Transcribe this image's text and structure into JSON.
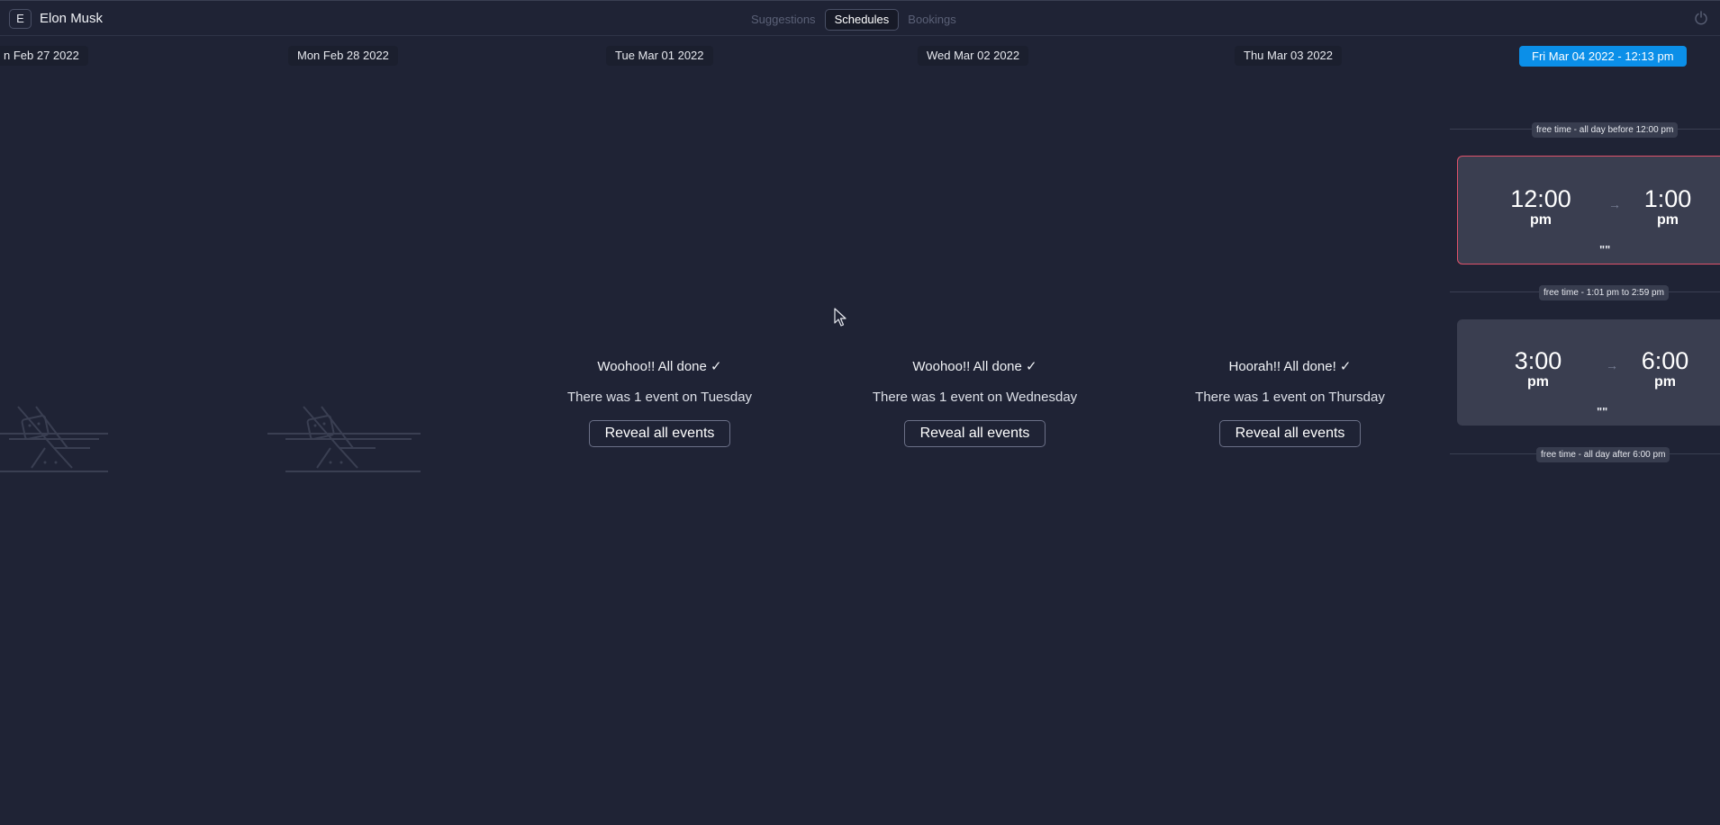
{
  "header": {
    "avatar_letter": "E",
    "username": "Elon Musk",
    "tabs": [
      "Suggestions",
      "Schedules",
      "Bookings"
    ],
    "active_tab": "Schedules"
  },
  "days": [
    {
      "date": "n Feb 27 2022"
    },
    {
      "date": "Mon Feb 28 2022"
    },
    {
      "date": "Tue Mar 01 2022",
      "title": "Woohoo!! All done ✓",
      "subtitle": "There was 1 event on Tuesday",
      "button": "Reveal all events"
    },
    {
      "date": "Wed Mar 02 2022",
      "title": "Woohoo!! All done ✓",
      "subtitle": "There was 1 event on Wednesday",
      "button": "Reveal all events"
    },
    {
      "date": "Thu Mar 03 2022",
      "title": "Hoorah!! All done! ✓",
      "subtitle": "There was 1 event on Thursday",
      "button": "Reveal all events"
    }
  ],
  "today": {
    "date": "Fri Mar 04 2022  - 12:13 pm",
    "free_before": "free time - all day before 12:00 pm",
    "event1": {
      "start": "12:00",
      "start_ampm": "pm",
      "end": "1:00",
      "end_ampm": "pm",
      "note": "\"\""
    },
    "free_between": "free time - 1:01 pm to 2:59 pm",
    "event2": {
      "start": "3:00",
      "start_ampm": "pm",
      "end": "6:00",
      "end_ampm": "pm",
      "note": "\"\""
    },
    "free_after": "free time - all day after 6:00 pm"
  },
  "colors": {
    "background": "#1f2335",
    "today_accent": "#0b8fe8",
    "current_event_border": "#e0526a",
    "event_card": "#3a3e50"
  },
  "icons": {
    "power": "power-icon",
    "arrow": "arrow-right-icon",
    "cursor": "mouse-cursor-icon",
    "illustration": "relax-chair-illustration"
  }
}
